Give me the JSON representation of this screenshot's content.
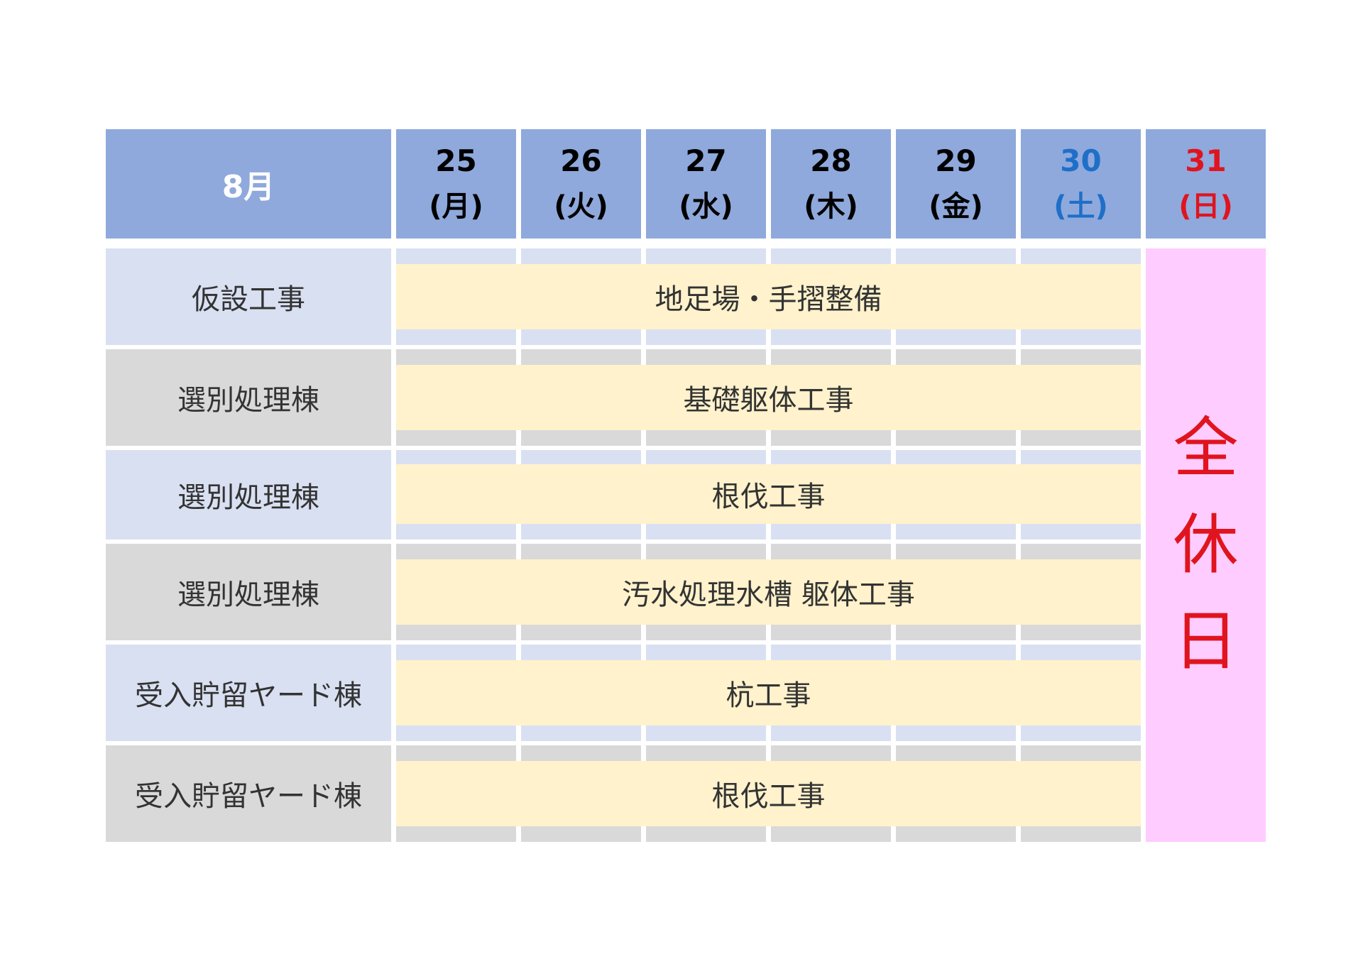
{
  "header": {
    "month": "8月",
    "days": [
      {
        "num": "25",
        "weekday": "(月)",
        "type": "weekday"
      },
      {
        "num": "26",
        "weekday": "(火)",
        "type": "weekday"
      },
      {
        "num": "27",
        "weekday": "(水)",
        "type": "weekday"
      },
      {
        "num": "28",
        "weekday": "(木)",
        "type": "weekday"
      },
      {
        "num": "29",
        "weekday": "(金)",
        "type": "weekday"
      },
      {
        "num": "30",
        "weekday": "(土)",
        "type": "saturday"
      },
      {
        "num": "31",
        "weekday": "(日)",
        "type": "sunday"
      }
    ]
  },
  "rows": [
    {
      "label": "仮設工事",
      "task": "地足場・手摺整備",
      "shade": "blue"
    },
    {
      "label": "選別処理棟",
      "task": "基礎躯体工事",
      "shade": "gray"
    },
    {
      "label": "選別処理棟",
      "task": "根伐工事",
      "shade": "blue"
    },
    {
      "label": "選別処理棟",
      "task": "汚水処理水槽 躯体工事",
      "shade": "gray"
    },
    {
      "label": "受入貯留ヤード棟",
      "task": "杭工事",
      "shade": "blue"
    },
    {
      "label": "受入貯留ヤード棟",
      "task": "根伐工事",
      "shade": "gray"
    }
  ],
  "holiday": {
    "chars": [
      "全",
      "休",
      "日"
    ]
  },
  "colors": {
    "header_bg": "#8fa9dc",
    "row_blue": "#d9e0f2",
    "row_gray": "#d9d9d9",
    "task_bg": "#fff2cc",
    "holiday_bg": "#ffccff",
    "saturday": "#1f6fc8",
    "sunday": "#e0141e"
  }
}
